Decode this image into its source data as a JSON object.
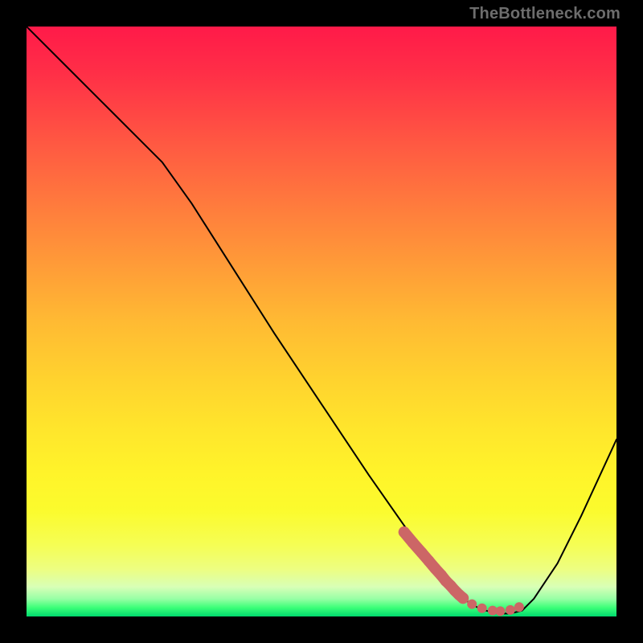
{
  "watermark": "TheBottleneck.com",
  "chart_data": {
    "type": "line",
    "title": "",
    "xlabel": "",
    "ylabel": "",
    "xlim": [
      0,
      100
    ],
    "ylim": [
      0,
      100
    ],
    "grid": false,
    "legend": false,
    "series": [
      {
        "name": "curve",
        "color": "#000000",
        "stroke": 2,
        "x": [
          0,
          7,
          14,
          20,
          23,
          28,
          35,
          42,
          50,
          58,
          65,
          70,
          74,
          77,
          80,
          82,
          84,
          86,
          90,
          94,
          100
        ],
        "y": [
          100,
          93,
          86,
          80,
          77,
          70,
          59,
          48,
          36,
          24,
          14,
          7,
          3,
          1.2,
          0.5,
          0.5,
          1,
          3,
          9,
          17,
          30
        ]
      },
      {
        "name": "highlight-dots",
        "color": "#cc6666",
        "marker": "circle",
        "radius_main": 7,
        "radius_small": 6,
        "x": [
          64,
          65.5,
          67,
          68.2,
          69.3,
          70.3,
          71.1,
          71.9,
          72.6,
          73.3,
          74,
          75.5,
          77.2,
          79,
          80.3,
          82,
          83.5
        ],
        "y": [
          14.3,
          12.5,
          10.8,
          9.4,
          8.1,
          7.0,
          6.0,
          5.2,
          4.4,
          3.7,
          3.1,
          2.1,
          1.4,
          1.0,
          0.9,
          1.1,
          1.6
        ]
      }
    ]
  }
}
